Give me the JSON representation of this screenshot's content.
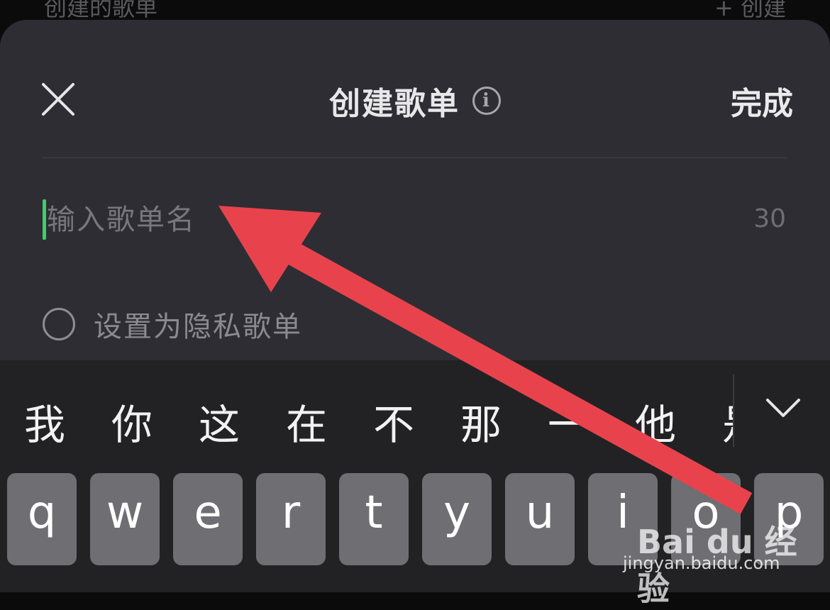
{
  "background": {
    "section_title": "创建的歌单",
    "create_label": "+ 创建"
  },
  "dialog": {
    "title": "创建歌单",
    "info_icon": "info-icon",
    "close_icon": "close-icon",
    "done_label": "完成",
    "name_placeholder": "输入歌单名",
    "name_value": "",
    "char_limit": "30",
    "private_label": "设置为隐私歌单",
    "private_checked": false
  },
  "keyboard": {
    "candidates": [
      "我",
      "你",
      "这",
      "在",
      "不",
      "那",
      "一",
      "他",
      "是"
    ],
    "collapse_icon": "chevron-down-icon",
    "row1": [
      "q",
      "w",
      "e",
      "r",
      "t",
      "y",
      "u",
      "i",
      "o",
      "p"
    ]
  },
  "colors": {
    "sheet_bg": "#2e2d33",
    "caret": "#3fcf63",
    "arrow": "#e8434c",
    "key_bg": "#6e6e73"
  },
  "watermark": {
    "logo": "Bai du 经验",
    "url": "jingyan.baidu.com"
  }
}
